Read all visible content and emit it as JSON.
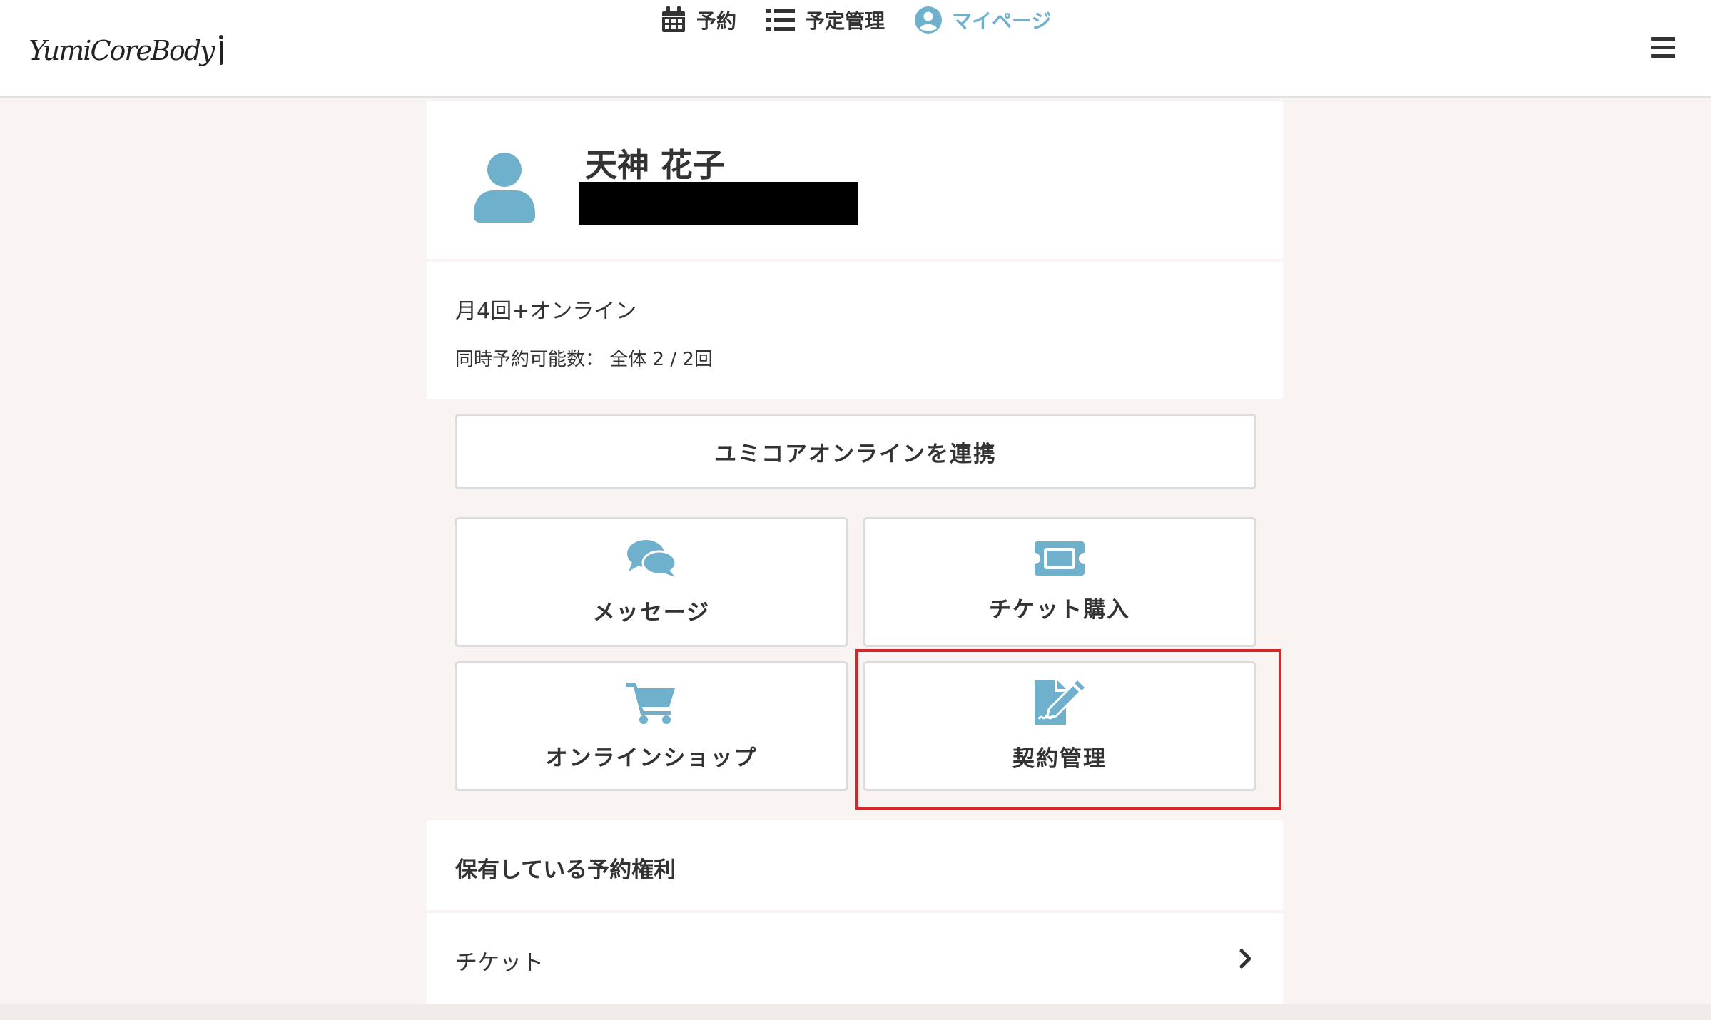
{
  "header": {
    "logo_text": "YumiCoreBody",
    "nav": [
      {
        "label": "予約",
        "icon": "calendar-icon"
      },
      {
        "label": "予定管理",
        "icon": "list-icon"
      },
      {
        "label": "マイページ",
        "icon": "user-circle-icon",
        "active": true
      }
    ],
    "menu_icon": "hamburger-menu-icon"
  },
  "profile": {
    "name": "天神 花子",
    "avatar_icon": "user-avatar-icon"
  },
  "plan": {
    "name": "月4回+オンライン",
    "limit_text": "同時予約可能数： 全体 2 / 2回"
  },
  "link_online_button": "ユミコアオンラインを連携",
  "tiles": {
    "message": {
      "label": "メッセージ",
      "icon": "chat-bubbles-icon"
    },
    "ticket": {
      "label": "チケット購入",
      "icon": "ticket-icon"
    },
    "shop": {
      "label": "オンラインショップ",
      "icon": "shopping-cart-icon"
    },
    "contract": {
      "label": "契約管理",
      "icon": "contract-signature-icon"
    }
  },
  "rights": {
    "title": "保有している予約権利",
    "ticket_row": "チケット"
  },
  "colors": {
    "accent": "#6fb0cc",
    "background": "#f9f3f1",
    "highlight": "#d62728"
  }
}
